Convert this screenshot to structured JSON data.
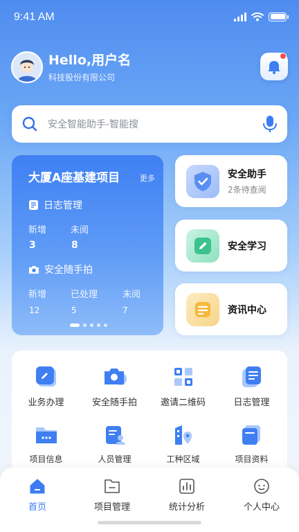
{
  "status_bar": {
    "time": "9:41 AM"
  },
  "header": {
    "greeting": "Hello,用户名",
    "company": "科技股份有限公司"
  },
  "search": {
    "placeholder": "安全智能助手-智能搜"
  },
  "project_card": {
    "title": "大厦A座基建项目",
    "more": "更多",
    "log_section": {
      "title": "日志管理",
      "stats": [
        {
          "label": "新增",
          "value": "3"
        },
        {
          "label": "未阅",
          "value": "8"
        }
      ]
    },
    "photo_section": {
      "title": "安全随手拍",
      "stats": [
        {
          "label": "新增",
          "value": "12"
        },
        {
          "label": "已处理",
          "value": "5"
        },
        {
          "label": "未阅",
          "value": "7"
        }
      ]
    },
    "pagination": {
      "pages": 5,
      "active": 1
    }
  },
  "side_cards": [
    {
      "title": "安全助手",
      "subtitle": "2条待查阅",
      "icon": "shield-check-icon"
    },
    {
      "title": "安全学习",
      "subtitle": "",
      "icon": "pencil-icon"
    },
    {
      "title": "资讯中心",
      "subtitle": "",
      "icon": "news-icon"
    }
  ],
  "grid_items": [
    {
      "label": "业务办理",
      "icon": "edit-icon"
    },
    {
      "label": "安全随手拍",
      "icon": "camera-icon"
    },
    {
      "label": "邀请二维码",
      "icon": "qrcode-icon"
    },
    {
      "label": "日志管理",
      "icon": "document-icon"
    },
    {
      "label": "项目信息",
      "icon": "folder-icon"
    },
    {
      "label": "人员管理",
      "icon": "person-card-icon"
    },
    {
      "label": "工种区域",
      "icon": "location-building-icon"
    },
    {
      "label": "项目资料",
      "icon": "files-icon"
    }
  ],
  "tabbar": [
    {
      "label": "首页",
      "icon": "home-icon",
      "active": true
    },
    {
      "label": "项目管理",
      "icon": "folder-tab-icon",
      "active": false
    },
    {
      "label": "统计分析",
      "icon": "bar-chart-icon",
      "active": false
    },
    {
      "label": "个人中心",
      "icon": "user-face-icon",
      "active": false
    }
  ],
  "colors": {
    "accent": "#3c7cf0",
    "badge": "#f5534f",
    "card_gradient_top": "#3f80f3"
  }
}
